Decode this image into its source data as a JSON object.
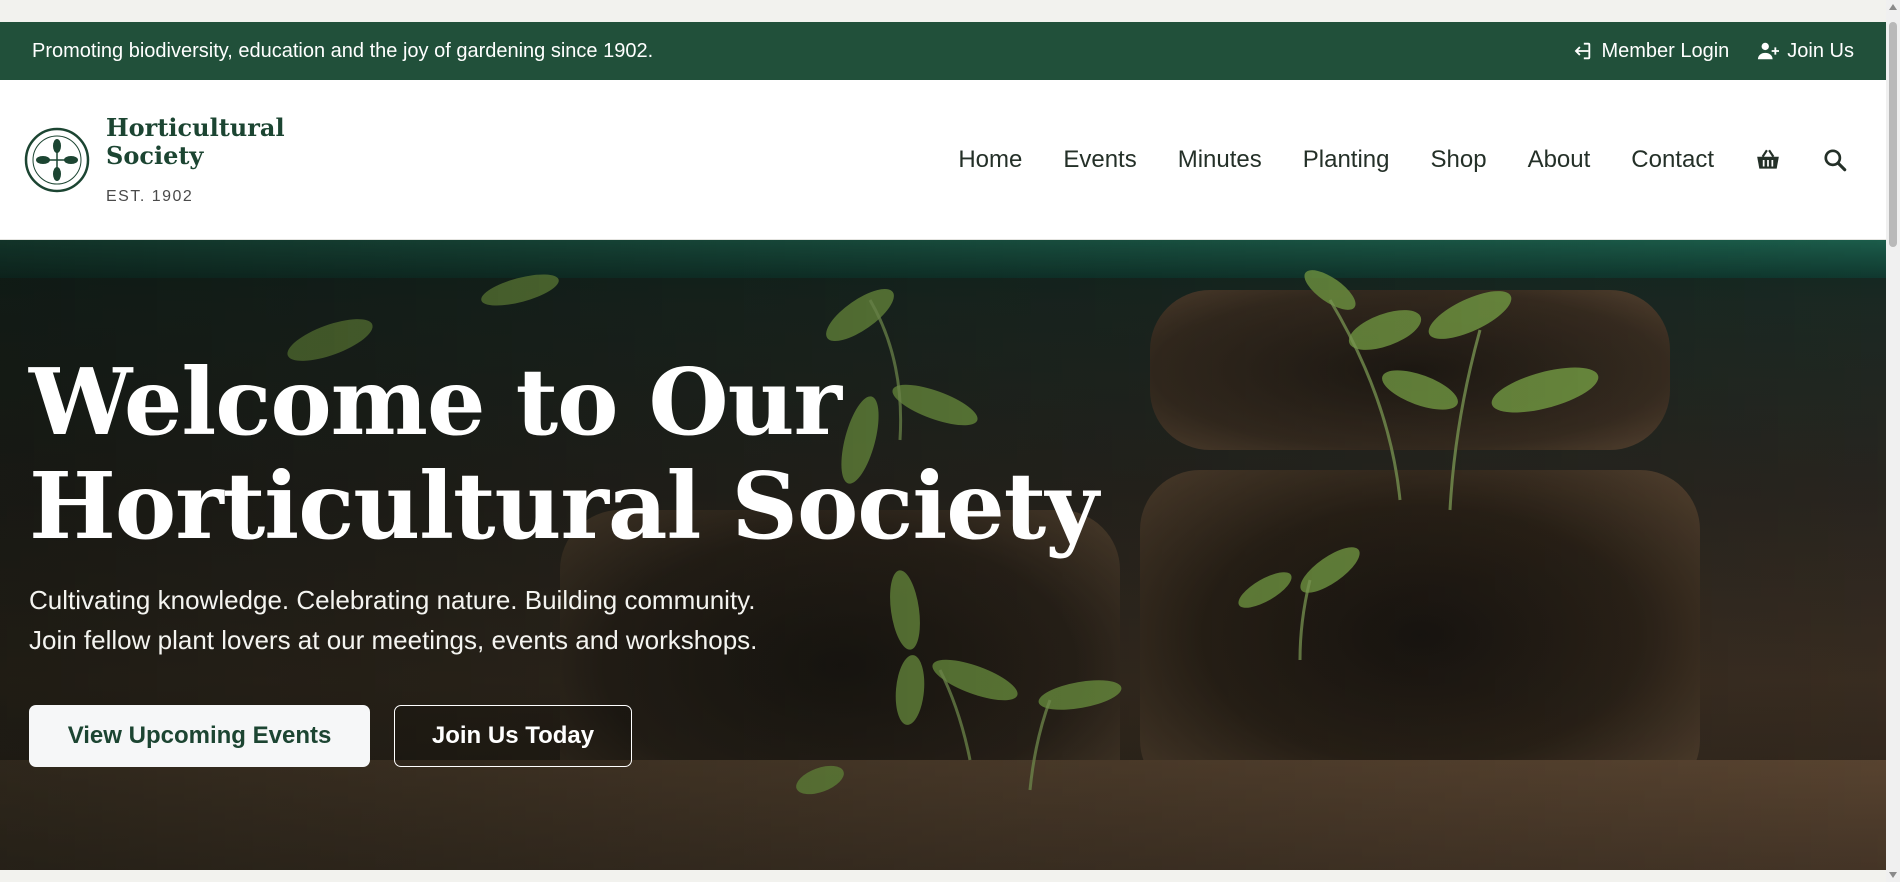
{
  "topbar": {
    "tagline": "Promoting biodiversity, education and the joy of gardening since 1902.",
    "member_login": "Member Login",
    "join_us": "Join Us"
  },
  "brand": {
    "name": "Horticultural Society",
    "established": "EST. 1902"
  },
  "nav": {
    "items": [
      "Home",
      "Events",
      "Minutes",
      "Planting",
      "Shop",
      "About",
      "Contact"
    ],
    "cart_icon": "basket-icon",
    "search_icon": "search-icon"
  },
  "hero": {
    "title_line1": "Welcome to Our",
    "title_line2": "Horticultural Society",
    "subtitle_line1": "Cultivating knowledge. Celebrating nature. Building community.",
    "subtitle_line2": "Join fellow plant lovers at our meetings, events and workshops.",
    "primary_button": "View Upcoming Events",
    "secondary_button": "Join Us Today"
  },
  "colors": {
    "brand_green": "#21503a",
    "dark_text": "#1c4532"
  }
}
